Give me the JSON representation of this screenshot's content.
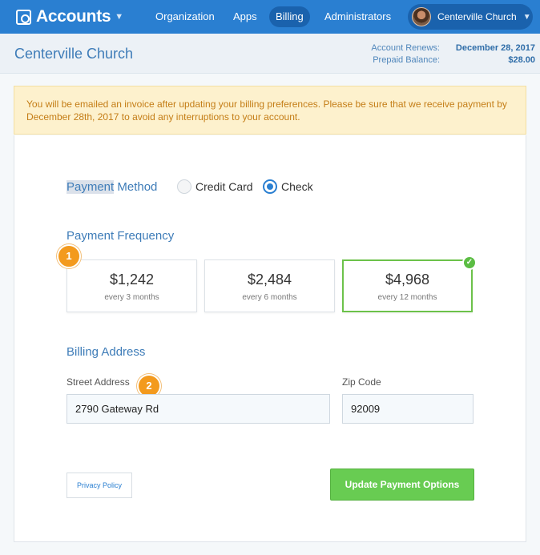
{
  "nav": {
    "brand": "Accounts",
    "brand_icon": "gear-box-icon",
    "items": [
      {
        "label": "Organization"
      },
      {
        "label": "Apps"
      },
      {
        "label": "Billing",
        "active": true
      },
      {
        "label": "Administrators"
      }
    ],
    "user_name": "Centerville Church"
  },
  "header": {
    "org_title": "Centerville Church",
    "renew_label": "Account Renews:",
    "renew_value": "December 28, 2017",
    "balance_label": "Prepaid Balance:",
    "balance_value": "$28.00"
  },
  "notice": "You will be emailed an invoice after updating your billing preferences. Please be sure that we receive payment by December 28th, 2017 to avoid any interruptions to your account.",
  "payment_method": {
    "label_highlight": "Payment",
    "label_rest": " Method",
    "options": [
      {
        "label": "Credit Card",
        "selected": false
      },
      {
        "label": "Check",
        "selected": true
      }
    ]
  },
  "frequency": {
    "title": "Payment Frequency",
    "options": [
      {
        "amount": "$1,242",
        "period": "every 3 months",
        "selected": false
      },
      {
        "amount": "$2,484",
        "period": "every 6 months",
        "selected": false
      },
      {
        "amount": "$4,968",
        "period": "every 12 months",
        "selected": true
      }
    ]
  },
  "steps": [
    "1",
    "2"
  ],
  "billing": {
    "title": "Billing Address",
    "street_label": "Street Address",
    "street_value": "2790 Gateway Rd",
    "zip_label": "Zip Code",
    "zip_value": "92009"
  },
  "buttons": {
    "privacy": "Privacy Policy",
    "update": "Update Payment Options"
  },
  "colors": {
    "nav_bg": "#2a7fd1",
    "accent_green": "#68cc52",
    "badge_orange": "#f39a1e",
    "notice_bg": "#fdf1cd"
  }
}
